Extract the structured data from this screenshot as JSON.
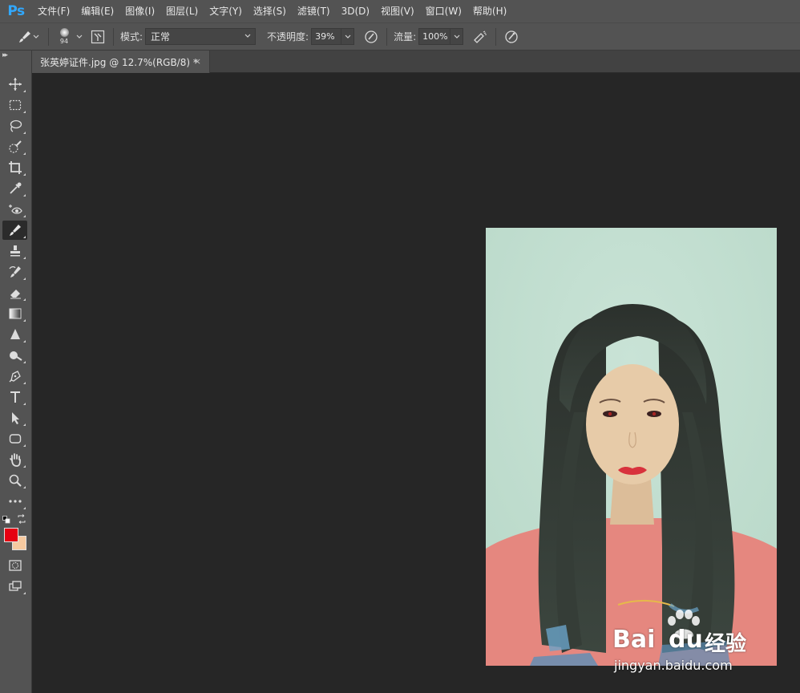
{
  "app": {
    "logo": "Ps"
  },
  "menu": [
    "文件(F)",
    "编辑(E)",
    "图像(I)",
    "图层(L)",
    "文字(Y)",
    "选择(S)",
    "滤镜(T)",
    "3D(D)",
    "视图(V)",
    "窗口(W)",
    "帮助(H)"
  ],
  "options": {
    "brush_size": "94",
    "mode_label": "模式:",
    "mode_value": "正常",
    "opacity_label": "不透明度:",
    "opacity_value": "39%",
    "flow_label": "流量:",
    "flow_value": "100%"
  },
  "document": {
    "tab_title": "张英婷证件.jpg @ 12.7%(RGB/8) *",
    "close_glyph": "×"
  },
  "colors": {
    "foreground": "#e60012",
    "background": "#f6c9a0",
    "photo_backdrop": "#c3dfd0",
    "shirt": "#e88a82",
    "hair": "#2a302a",
    "skin": "#e7cba8",
    "lips": "#d8323c"
  },
  "tools": [
    "move-tool",
    "marquee-tool",
    "lasso-tool",
    "quick-selection-tool",
    "crop-tool",
    "eyedropper-tool",
    "red-eye-tool",
    "brush-tool",
    "clone-stamp-tool",
    "history-brush-tool",
    "eraser-tool",
    "gradient-tool",
    "sharpen-tool",
    "dodge-tool",
    "pen-tool",
    "type-tool",
    "path-selection-tool",
    "rectangle-tool",
    "hand-tool",
    "zoom-tool",
    "more-tools"
  ],
  "watermark": {
    "brand_latin": "Bai",
    "brand_latin_end": "du",
    "brand_cn": "经验",
    "site": "jingyan.baidu.com"
  }
}
